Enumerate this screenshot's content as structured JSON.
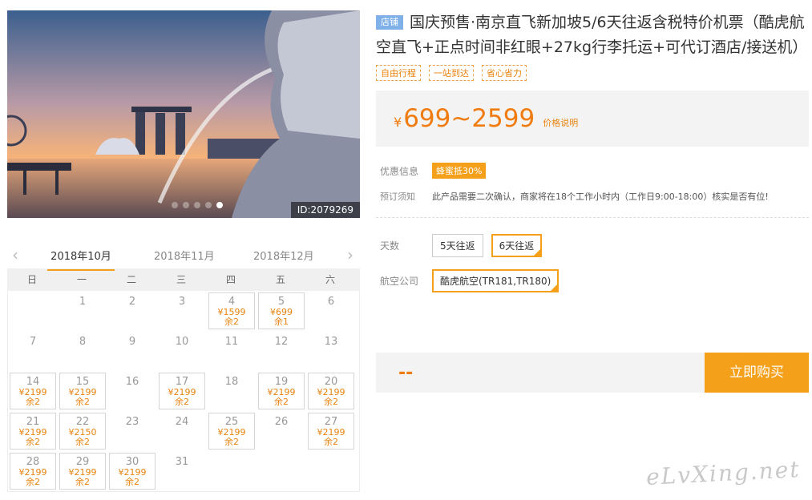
{
  "hero": {
    "image_id": "ID:2079269",
    "dots": [
      false,
      false,
      false,
      false,
      true
    ]
  },
  "calendar": {
    "months": [
      "2018年10月",
      "2018年11月",
      "2018年12月"
    ],
    "weekdays": [
      "日",
      "一",
      "二",
      "三",
      "四",
      "五",
      "六"
    ],
    "days": [
      {
        "d": "",
        "p": "",
        "s": ""
      },
      {
        "d": "1",
        "p": "",
        "s": ""
      },
      {
        "d": "2",
        "p": "",
        "s": ""
      },
      {
        "d": "3",
        "p": "",
        "s": ""
      },
      {
        "d": "4",
        "p": "¥1599",
        "s": "余2"
      },
      {
        "d": "5",
        "p": "¥699",
        "s": "余1"
      },
      {
        "d": "6",
        "p": "",
        "s": ""
      },
      {
        "d": "7",
        "p": "",
        "s": ""
      },
      {
        "d": "8",
        "p": "",
        "s": ""
      },
      {
        "d": "9",
        "p": "",
        "s": ""
      },
      {
        "d": "10",
        "p": "",
        "s": ""
      },
      {
        "d": "11",
        "p": "",
        "s": ""
      },
      {
        "d": "12",
        "p": "",
        "s": ""
      },
      {
        "d": "13",
        "p": "",
        "s": ""
      },
      {
        "d": "14",
        "p": "¥2199",
        "s": "余2"
      },
      {
        "d": "15",
        "p": "¥2199",
        "s": "余2"
      },
      {
        "d": "16",
        "p": "",
        "s": ""
      },
      {
        "d": "17",
        "p": "¥2199",
        "s": "余2"
      },
      {
        "d": "18",
        "p": "",
        "s": ""
      },
      {
        "d": "19",
        "p": "¥2199",
        "s": "余2"
      },
      {
        "d": "20",
        "p": "¥2199",
        "s": "余2"
      },
      {
        "d": "21",
        "p": "¥2199",
        "s": "余2"
      },
      {
        "d": "22",
        "p": "¥2150",
        "s": "余2"
      },
      {
        "d": "23",
        "p": "",
        "s": ""
      },
      {
        "d": "24",
        "p": "",
        "s": ""
      },
      {
        "d": "25",
        "p": "¥2199",
        "s": "余2"
      },
      {
        "d": "26",
        "p": "",
        "s": ""
      },
      {
        "d": "27",
        "p": "¥2199",
        "s": "余2"
      },
      {
        "d": "28",
        "p": "¥2199",
        "s": "余2"
      },
      {
        "d": "29",
        "p": "¥2199",
        "s": "余2"
      },
      {
        "d": "30",
        "p": "¥2199",
        "s": "余2"
      },
      {
        "d": "31",
        "p": "",
        "s": ""
      }
    ]
  },
  "product": {
    "shop_badge": "店铺",
    "title": "国庆预售·南京直飞新加坡5/6天往返含税特价机票（酷虎航空直飞+正点时间非红眼+27kg行李托运+可代订酒店/接送机）",
    "tags": [
      "自由行程",
      "一站到达",
      "省心省力"
    ],
    "currency": "¥",
    "price": "699~2599",
    "price_note": "价格说明",
    "promo_label": "优惠信息",
    "promo_tag": "蜂蜜抵30%",
    "notice_label": "预订须知",
    "notice_text": "此产品需要二次确认，商家将在18个工作小时内（工作日9:00-18:00）核实是否有位!",
    "days_label": "天数",
    "day_options": [
      "5天往返",
      "6天往返"
    ],
    "airline_label": "航空公司",
    "airline_option": "酷虎航空(TR181,TR180)",
    "total_display": "--",
    "buy_label": "立即购买"
  },
  "watermark": "eLvXing.net",
  "colors": {
    "accent": "#f5a01a",
    "price": "#f07c10",
    "shop_badge": "#7fb1e8"
  }
}
